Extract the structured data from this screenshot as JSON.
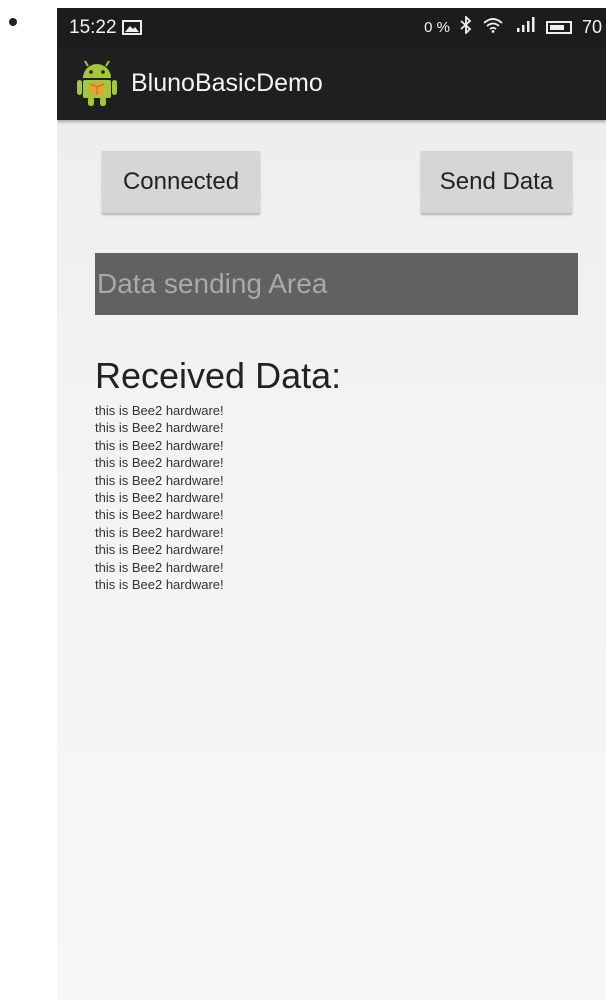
{
  "status_bar": {
    "time": "15:22",
    "data_speed": "0 %",
    "battery_level": "70"
  },
  "app_bar": {
    "title": "BlunoBasicDemo"
  },
  "buttons": {
    "connect_label": "Connected",
    "send_label": "Send Data"
  },
  "send_input": {
    "placeholder": "Data sending Area",
    "value": ""
  },
  "received": {
    "title": "Received Data:",
    "lines": [
      "this is Bee2 hardware!",
      "this is Bee2 hardware!",
      "this is Bee2 hardware!",
      "this is Bee2 hardware!",
      "this is Bee2 hardware!",
      "this is Bee2 hardware!",
      "this is Bee2 hardware!",
      "this is Bee2 hardware!",
      "this is Bee2 hardware!",
      "this is Bee2 hardware!",
      "this is Bee2 hardware!"
    ]
  },
  "icons": {
    "status_image": "image-icon",
    "bluetooth": "bluetooth-icon",
    "wifi": "wifi-icon",
    "signal": "signal-icon",
    "battery": "battery-icon",
    "app": "android-app-icon"
  },
  "colors": {
    "status_bar_bg": "#1c1c1c",
    "app_bar_bg": "#1f1f1f",
    "button_bg": "#d6d6d6",
    "input_bg": "#616161",
    "android_green": "#a4c639"
  }
}
